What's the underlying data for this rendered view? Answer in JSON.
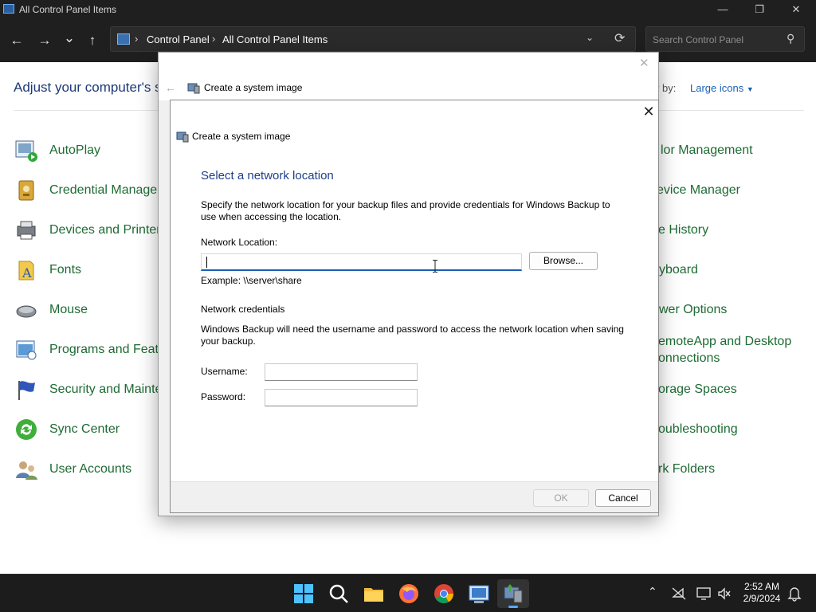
{
  "window": {
    "title": "All Control Panel Items",
    "minimize": "—",
    "maximize": "❐",
    "close": "✕"
  },
  "nav": {
    "back": "←",
    "forward": "→",
    "recent": "⌄",
    "up": "↑",
    "breadcrumb": [
      "Control Panel",
      "All Control Panel Items"
    ],
    "separator": "›",
    "dropdown": "⌄",
    "refresh": "⟳",
    "search_placeholder": "Search Control Panel",
    "search_icon": "⚲"
  },
  "control_panel": {
    "adjust_text": "Adjust your computer's se",
    "view_by_label": "w by:",
    "view_by_value": "Large icons",
    "view_by_caret": "▼",
    "left_items": [
      "AutoPlay",
      "Credential Manager",
      "Devices and Printers",
      "Fonts",
      "Mouse",
      "Programs and Featu",
      "Security and Mainte",
      "Sync Center",
      "User Accounts"
    ],
    "right_items": [
      "lor Management",
      "evice Manager",
      "e History",
      "yboard",
      "wer Options",
      "emoteApp and Desktop",
      "onnections",
      "orage Spaces",
      "oubleshooting",
      "rk Folders"
    ]
  },
  "back_dialog": {
    "title": "Create a system image",
    "close": "✕",
    "back": "←"
  },
  "dialog": {
    "title": "Create a system image",
    "close": "✕",
    "heading": "Select a network location",
    "description": "Specify the network location for your backup files and provide credentials for Windows Backup to use when accessing the location.",
    "network_location_label": "Network Location:",
    "network_location_value": "",
    "browse_button": "Browse...",
    "example": "Example: \\\\server\\share",
    "credentials_heading": "Network credentials",
    "credentials_description": "Windows Backup will need the username and password to access the network location when saving your backup.",
    "username_label": "Username:",
    "username_value": "",
    "password_label": "Password:",
    "password_value": "",
    "ok_button": "OK",
    "cancel_button": "Cancel"
  },
  "taskbar": {
    "time": "2:52 AM",
    "date": "2/9/2024",
    "tray_chevron": "⌃"
  },
  "colors": {
    "accent": "#1a5fb4",
    "heading": "#1f3f8c",
    "cp_link": "#1e6b33"
  }
}
